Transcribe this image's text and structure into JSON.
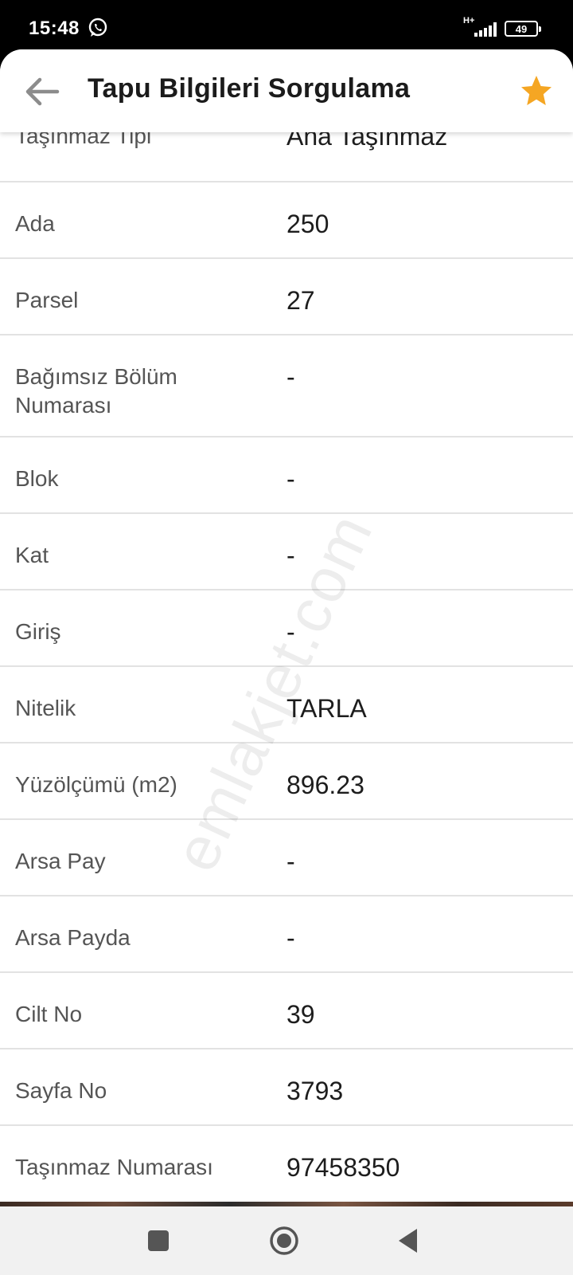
{
  "status_bar": {
    "time": "15:48",
    "network_type": "H+",
    "battery_level": "49",
    "icons": [
      "whatsapp-icon",
      "signal-icon",
      "battery-icon"
    ]
  },
  "header": {
    "title": "Tapu Bilgileri Sorgulama",
    "back_icon": "arrow-left-icon",
    "favorite_icon": "star-icon",
    "accent_color": "#F5A623"
  },
  "details": [
    {
      "label": "Taşınmaz Tipi",
      "value": "Ana Taşınmaz"
    },
    {
      "label": "Ada",
      "value": "250"
    },
    {
      "label": "Parsel",
      "value": "27"
    },
    {
      "label": "Bağımsız Bölüm Numarası",
      "value": "-"
    },
    {
      "label": "Blok",
      "value": "-"
    },
    {
      "label": "Kat",
      "value": "-"
    },
    {
      "label": "Giriş",
      "value": "-"
    },
    {
      "label": "Nitelik",
      "value": "TARLA"
    },
    {
      "label": "Yüzölçümü (m2)",
      "value": "896.23"
    },
    {
      "label": "Arsa Pay",
      "value": "-"
    },
    {
      "label": "Arsa Payda",
      "value": "-"
    },
    {
      "label": "Cilt No",
      "value": "39"
    },
    {
      "label": "Sayfa No",
      "value": "3793"
    },
    {
      "label": "Taşınmaz Numarası",
      "value": "97458350"
    }
  ],
  "watermark": "emlakjet.com",
  "nav_bar": {
    "icons": [
      "recents-icon",
      "home-icon",
      "back-icon"
    ]
  }
}
